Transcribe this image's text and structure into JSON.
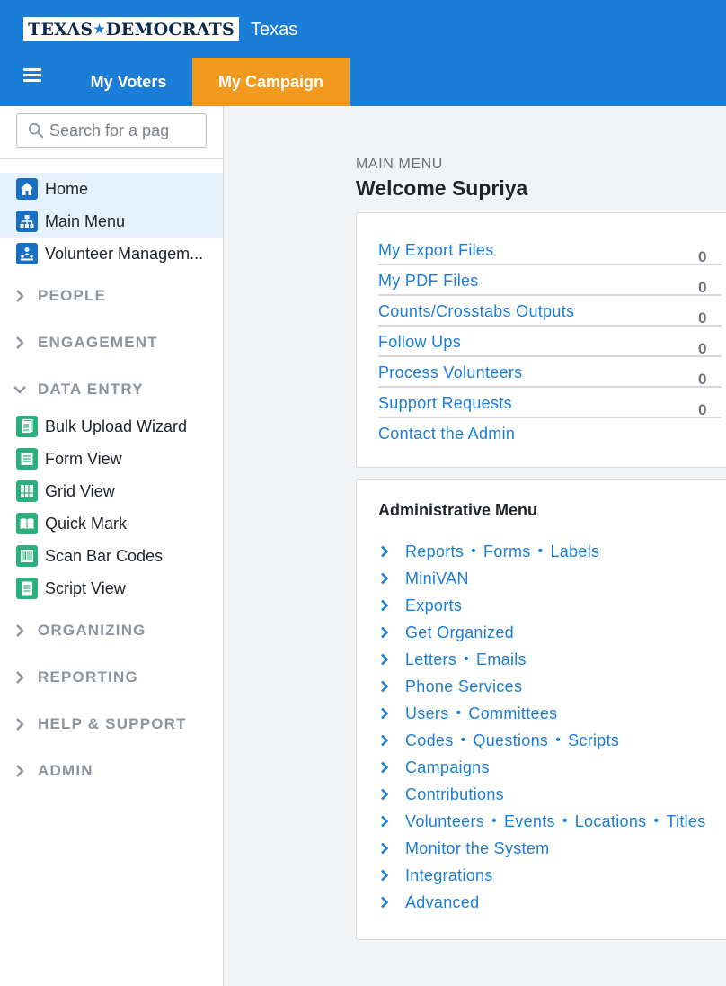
{
  "header": {
    "logo_text": "TEXAS DEMOCRATS",
    "state": "Texas",
    "tabs": [
      {
        "label": "My Voters"
      },
      {
        "label": "My Campaign"
      }
    ]
  },
  "sidebar": {
    "search_placeholder": "Search for a pag",
    "items": [
      {
        "label": "Home",
        "icon": "home-icon"
      },
      {
        "label": "Main Menu",
        "icon": "sitemap-icon"
      },
      {
        "label": "Volunteer Managem...",
        "icon": "volunteer-icon"
      }
    ],
    "sections": [
      "PEOPLE",
      "ENGAGEMENT",
      "DATA ENTRY",
      "ORGANIZING",
      "REPORTING",
      "HELP & SUPPORT",
      "ADMIN"
    ],
    "data_entry_items": [
      {
        "label": "Bulk Upload Wizard",
        "icon": "bulk-upload-icon"
      },
      {
        "label": "Form View",
        "icon": "form-view-icon"
      },
      {
        "label": "Grid View",
        "icon": "grid-view-icon"
      },
      {
        "label": "Quick Mark",
        "icon": "quick-mark-icon"
      },
      {
        "label": "Scan Bar Codes",
        "icon": "barcode-icon"
      },
      {
        "label": "Script View",
        "icon": "script-view-icon"
      }
    ]
  },
  "main": {
    "breadcrumb": "MAIN MENU",
    "welcome": "Welcome Supriya",
    "stats": [
      {
        "label": "My Export Files",
        "count": "0"
      },
      {
        "label": "My PDF Files",
        "count": "0"
      },
      {
        "label": "Counts/Crosstabs Outputs",
        "count": "0"
      },
      {
        "label": "Follow Ups",
        "count": "0"
      },
      {
        "label": "Process Volunteers",
        "count": "0"
      },
      {
        "label": "Support Requests",
        "count": "0"
      },
      {
        "label": "Contact the Admin",
        "count": ""
      }
    ],
    "admin_title": "Administrative Menu",
    "admin_rows": [
      [
        "Reports",
        "Forms",
        "Labels"
      ],
      [
        "MiniVAN"
      ],
      [
        "Exports"
      ],
      [
        "Get Organized"
      ],
      [
        "Letters",
        "Emails"
      ],
      [
        "Phone Services"
      ],
      [
        "Users",
        "Committees"
      ],
      [
        "Codes",
        "Questions",
        "Scripts"
      ],
      [
        "Campaigns"
      ],
      [
        "Contributions"
      ],
      [
        "Volunteers",
        "Events",
        "Locations",
        "Titles"
      ],
      [
        "Monitor the System"
      ],
      [
        "Integrations"
      ],
      [
        "Advanced"
      ]
    ]
  },
  "colors": {
    "header_blue": "#1a7dd7",
    "active_tab_orange": "#f39a1e",
    "link_blue": "#1a7dd7",
    "active_item_bg": "#e6f2fb"
  }
}
